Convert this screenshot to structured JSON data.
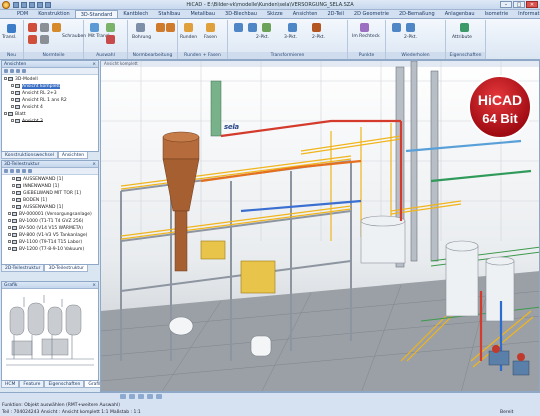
{
  "window": {
    "title": "HiCAD - E:\\Bilder-vk\\modelle\\Kunden\\sela\\VERSORGUNG_SELA.SZA",
    "min_label": "–",
    "max_label": "□",
    "close_label": "✕"
  },
  "ribbon": {
    "tabs": [
      "PDM",
      "Konstruktion",
      "3D-Standard",
      "Kantblech",
      "Stahlbau",
      "Metallbau",
      "3D-Blechbau",
      "Skizze",
      "Ansichten",
      "2D-Teil",
      "2D Geometrie",
      "2D-Bemaßung",
      "Anlagenbau",
      "Isometrie",
      "Information"
    ],
    "active_tab": "3D-Standard",
    "groups": [
      {
        "label": "Neu"
      },
      {
        "label": "Normteile"
      },
      {
        "label": "Auswahl"
      },
      {
        "label": "Normbearbeitung"
      },
      {
        "label": "Runden + Fasen"
      },
      {
        "label": "Transformieren"
      },
      {
        "label": "Punkte"
      },
      {
        "label": "Wiederholen"
      },
      {
        "label": "Eigenschaften"
      }
    ],
    "buttons": [
      {
        "label": "Transl."
      },
      {
        "label": "Schrauben"
      },
      {
        "label": "Mit Transl."
      },
      {
        "label": "Bohrung"
      },
      {
        "label": "Runden"
      },
      {
        "label": "Fasen"
      },
      {
        "label": "2-Pkt."
      },
      {
        "label": "3-Pkt."
      },
      {
        "label": "2-Pkt."
      },
      {
        "label": "Im Rechteck"
      },
      {
        "label": "2-Pkt."
      },
      {
        "label": "Attribute"
      }
    ]
  },
  "ansichten_panel": {
    "title": "Ansichten",
    "items": [
      {
        "label": "3D-Modell",
        "indent": 0,
        "selected": false,
        "strike": false
      },
      {
        "label": "Ansicht komplett",
        "indent": 1,
        "selected": true,
        "strike": false
      },
      {
        "label": "Ansicht RL 2+3",
        "indent": 1,
        "selected": false,
        "strike": false
      },
      {
        "label": "Ansicht RL 1 ans R2",
        "indent": 1,
        "selected": false,
        "strike": false
      },
      {
        "label": "Ansicht 4",
        "indent": 1,
        "selected": false,
        "strike": false
      },
      {
        "label": "Blatt",
        "indent": 0,
        "selected": false,
        "strike": false
      },
      {
        "label": "Ansicht 3",
        "indent": 1,
        "selected": false,
        "strike": true
      }
    ],
    "tabs": [
      "Konstruktionswechsel",
      "Ansichten"
    ]
  },
  "teilestruktur_panel": {
    "title": "3D-Teilestruktur",
    "items": [
      {
        "label": "AUSSENWAND [1]"
      },
      {
        "label": "INNENWAND [1]"
      },
      {
        "label": "GIEBELWAND MIT TOR [1]"
      },
      {
        "label": "BODEN [1]"
      },
      {
        "label": "AUSSENWAND [1]"
      },
      {
        "label": "BV-000001 (Versorgungsanlage)"
      },
      {
        "label": "BV-1000 (T1-T1 T4 GVZ 256)"
      },
      {
        "label": "BV-500 (V14 V15 WÄRMETA)"
      },
      {
        "label": "BV-800 (V1-V3 V5 Tankanlage)"
      },
      {
        "label": "BV-1100 (T9-T14 T15 Labor)"
      },
      {
        "label": "BV-1200 (T7-8-9-10 Vakuum)"
      }
    ],
    "tabs": [
      "2D-Teilestruktur",
      "3D-Teilestruktur"
    ]
  },
  "grafik_panel": {
    "title": "Grafik",
    "tabs": [
      "HCM",
      "Feature",
      "Eigenschaften",
      "Grafik"
    ]
  },
  "viewport": {
    "header": "Ansicht komplett",
    "brand": "sela",
    "hicad_logo": {
      "line1": "HiCAD",
      "line2": "64 Bit"
    }
  },
  "statusbar": {
    "prompt": "Funktion: Objekt auswählen (RMT+weitere Auswahl)",
    "info": "Teil : 704024243   Ansicht : Ansicht komplett 1:1   Maßstab : 1:1",
    "status": "Bereit"
  }
}
